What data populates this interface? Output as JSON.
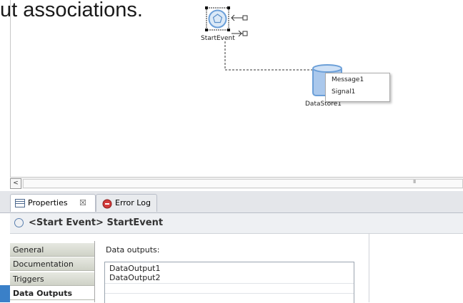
{
  "slide": {
    "text_fragment": "ut associations."
  },
  "diagram": {
    "start_event_label": "StartEvent",
    "datastore_label": "DataStore1",
    "popup_items": [
      "Message1",
      "Signal1"
    ]
  },
  "scrollbar": {
    "left_arrow": "<",
    "thumb_grip": "III"
  },
  "tabs": [
    {
      "label": "Properties",
      "close": "☒"
    },
    {
      "label": "Error Log"
    }
  ],
  "header": {
    "title": "<Start Event> StartEvent"
  },
  "sidebar": {
    "items": [
      {
        "label": "General"
      },
      {
        "label": "Documentation"
      },
      {
        "label": "Triggers"
      },
      {
        "label": "Data Outputs",
        "selected": true
      }
    ]
  },
  "data_outputs": {
    "label": "Data outputs:",
    "rows": [
      "DataOutput1",
      "DataOutput2"
    ]
  },
  "colors": {
    "accent": "#6b9fd8",
    "tab_border": "#b9bec8",
    "sidebar_grad_top": "#e6e8e1"
  }
}
